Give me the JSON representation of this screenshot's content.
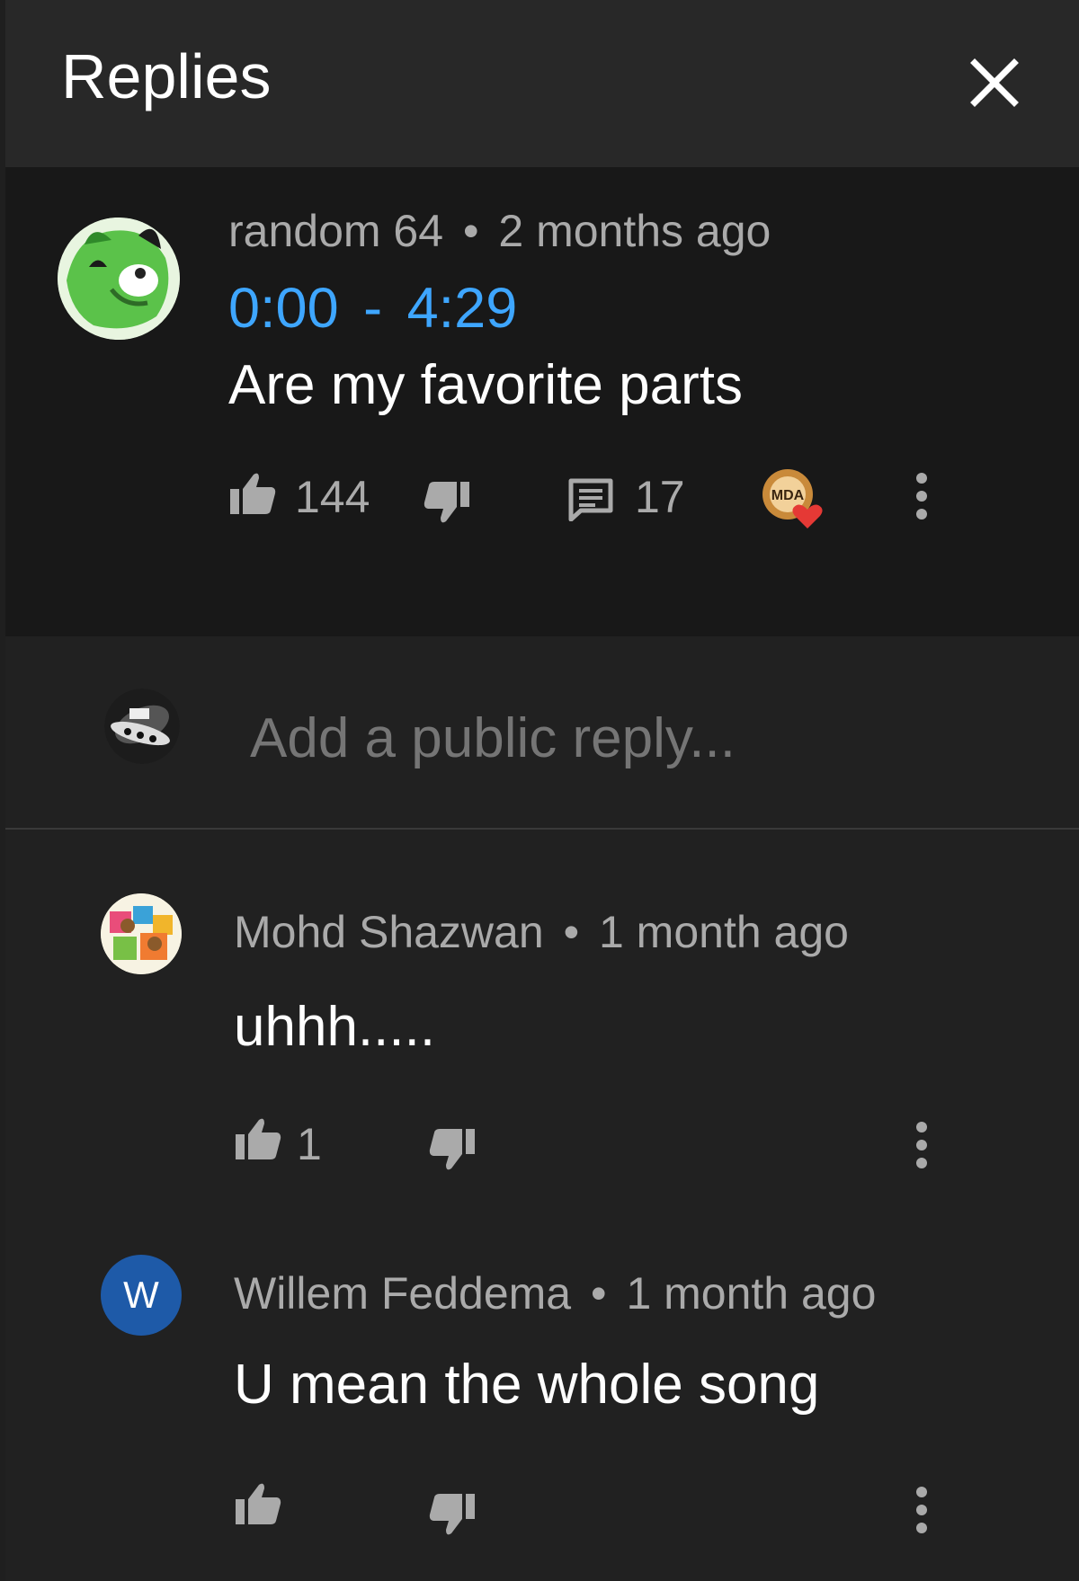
{
  "header": {
    "title": "Replies",
    "close_icon": "close-icon"
  },
  "main_comment": {
    "author": "random 64",
    "separator": "•",
    "time": "2 months ago",
    "timestamp_start": "0:00",
    "timestamp_dash": "-",
    "timestamp_end": "4:29",
    "text": "Are my favorite parts",
    "likes": "144",
    "replies": "17",
    "creator_badge_text": "MDA"
  },
  "reply_box": {
    "placeholder": "Add a public reply..."
  },
  "replies": [
    {
      "author": "Mohd Shazwan",
      "separator": "•",
      "time": "1 month ago",
      "text": "uhhh.....",
      "likes": "1"
    },
    {
      "author": "Willem Feddema",
      "separator": "•",
      "time": "1 month ago",
      "text": "U mean the whole song",
      "likes": "",
      "avatar_letter": "W",
      "avatar_color": "#1e5aa8"
    }
  ],
  "colors": {
    "link": "#3ea6ff",
    "secondary_text": "#aaaaaa",
    "header_bg": "#282828",
    "highlight_bg": "#181818"
  }
}
